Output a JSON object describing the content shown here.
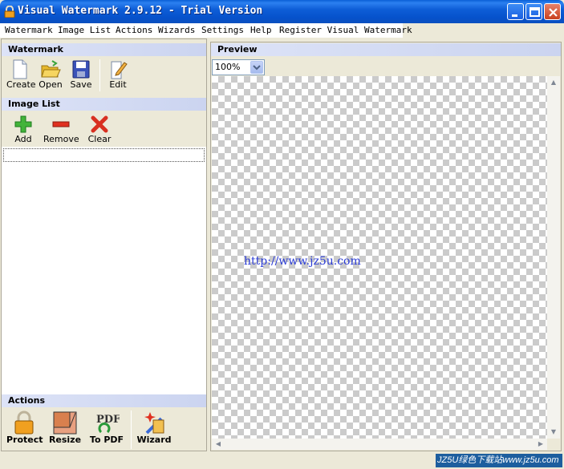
{
  "window": {
    "title": "Visual Watermark 2.9.12 - Trial Version"
  },
  "menu": [
    "Watermark",
    "Image List",
    "Actions",
    "Wizards",
    "Settings",
    "Help",
    "Register Visual Watermark"
  ],
  "watermark_section": {
    "title": "Watermark",
    "tools": [
      {
        "label": "Create",
        "icon": "document-icon"
      },
      {
        "label": "Open",
        "icon": "folder-open-icon"
      },
      {
        "label": "Save",
        "icon": "floppy-disk-icon"
      },
      {
        "label": "Edit",
        "icon": "edit-pencil-icon"
      }
    ]
  },
  "image_list_section": {
    "title": "Image List",
    "tools": [
      {
        "label": "Add",
        "icon": "plus-icon"
      },
      {
        "label": "Remove",
        "icon": "minus-icon"
      },
      {
        "label": "Clear",
        "icon": "x-icon"
      }
    ]
  },
  "actions_section": {
    "title": "Actions",
    "tools": [
      {
        "label": "Protect",
        "icon": "padlock-icon"
      },
      {
        "label": "Resize",
        "icon": "resize-icon"
      },
      {
        "label": "To PDF",
        "icon": "pdf-icon",
        "icon_text": "PDF"
      },
      {
        "label": "Wizard",
        "icon": "wizard-icon"
      }
    ]
  },
  "preview": {
    "title": "Preview",
    "zoom": "100%",
    "watermark_text": "http://www.jz5u.com"
  },
  "site_watermark": "JZ5U绿色下载站www.jz5u.com",
  "colors": {
    "titlebar": "#0652cc",
    "section_header": "#cbd4f0",
    "watermark_text": "#2b3cd6"
  }
}
